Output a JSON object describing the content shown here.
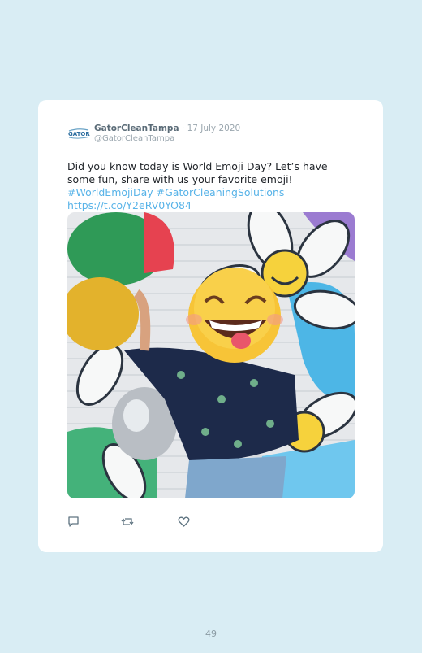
{
  "tweet": {
    "author_name": "GatorCleanTampa",
    "separator": " · ",
    "date": "17 July 2020",
    "handle": "@GatorCleanTampa",
    "logo_text": "GATOR",
    "text_main": "Did you know today is World Emoji Day? Let’s have some fun, share with us your favorite emoji! ",
    "hashtag1": "#WorldEmojiDay",
    "hashtag2": "#GatorCleaningSolutions",
    "url": "https://t.co/Y2eRV0YO84"
  },
  "actions": [
    "reply-icon",
    "retweet-icon",
    "like-icon"
  ],
  "colors": {
    "background": "#d9edf4",
    "card": "#ffffff",
    "link": "#58b3e8",
    "icon": "#5f7481"
  },
  "page": {
    "number": "49"
  }
}
